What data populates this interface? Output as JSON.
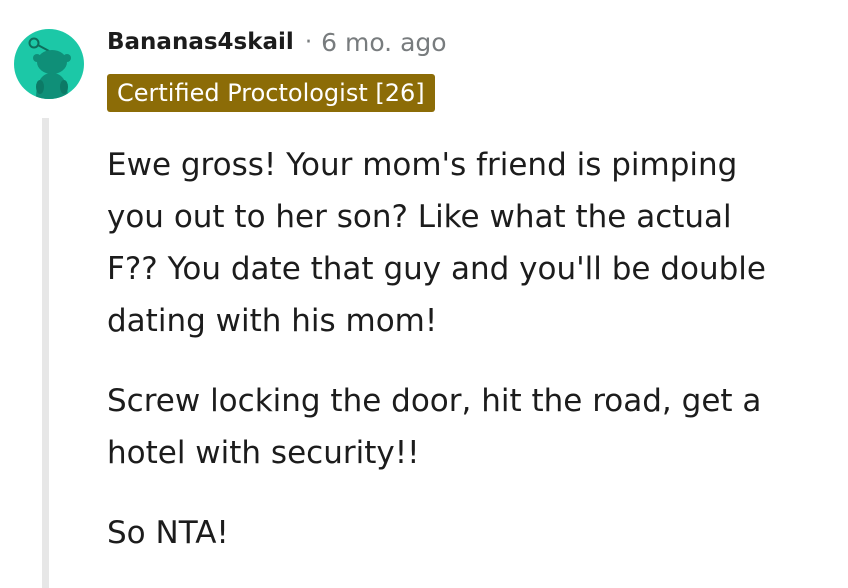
{
  "comment": {
    "author": "Bananas4skail",
    "separator": "·",
    "age": "6 mo. ago",
    "flair": "Certified Proctologist [26]",
    "paragraphs": [
      [
        "Ewe gross! Your mom's friend is pimping",
        "you out to her son? Like what the actual",
        "F?? You date that guy and you'll be double",
        "dating with his mom!"
      ],
      [
        "Screw locking the door, hit the road, get a",
        "hotel with security!!"
      ],
      [
        "So NTA!"
      ]
    ]
  },
  "colors": {
    "avatar_bg": "#1cc8a7",
    "flair_bg": "#8c6c07",
    "flair_text": "#ffffff",
    "muted_text": "#787c7e",
    "thread_line": "#e7e7e7"
  },
  "icons": {
    "avatar": "snoo-avatar-icon"
  }
}
